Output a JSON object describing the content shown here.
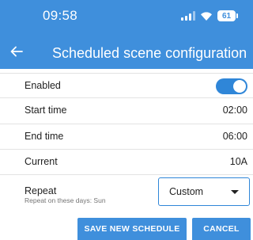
{
  "status_bar": {
    "time": "09:58",
    "battery": "61",
    "icons": [
      "signal-icon",
      "wifi-icon",
      "battery-icon"
    ]
  },
  "app_bar": {
    "title": "Scheduled scene configuration",
    "back_icon": "arrow-left-icon"
  },
  "settings": {
    "enabled_label": "Enabled",
    "enabled_state": true,
    "start_time_label": "Start time",
    "start_time_value": "02:00",
    "end_time_label": "End time",
    "end_time_value": "06:00",
    "current_label": "Current",
    "current_value": "10A",
    "repeat_label": "Repeat",
    "repeat_sub": "Repeat on these days: Sun",
    "repeat_selected": "Custom"
  },
  "actions": {
    "save_label": "SAVE NEW SCHEDULE",
    "cancel_label": "CANCEL"
  },
  "colors": {
    "primary": "#3f8fdc",
    "toggle_on": "#2f86d8",
    "divider": "#e3e3e3"
  }
}
